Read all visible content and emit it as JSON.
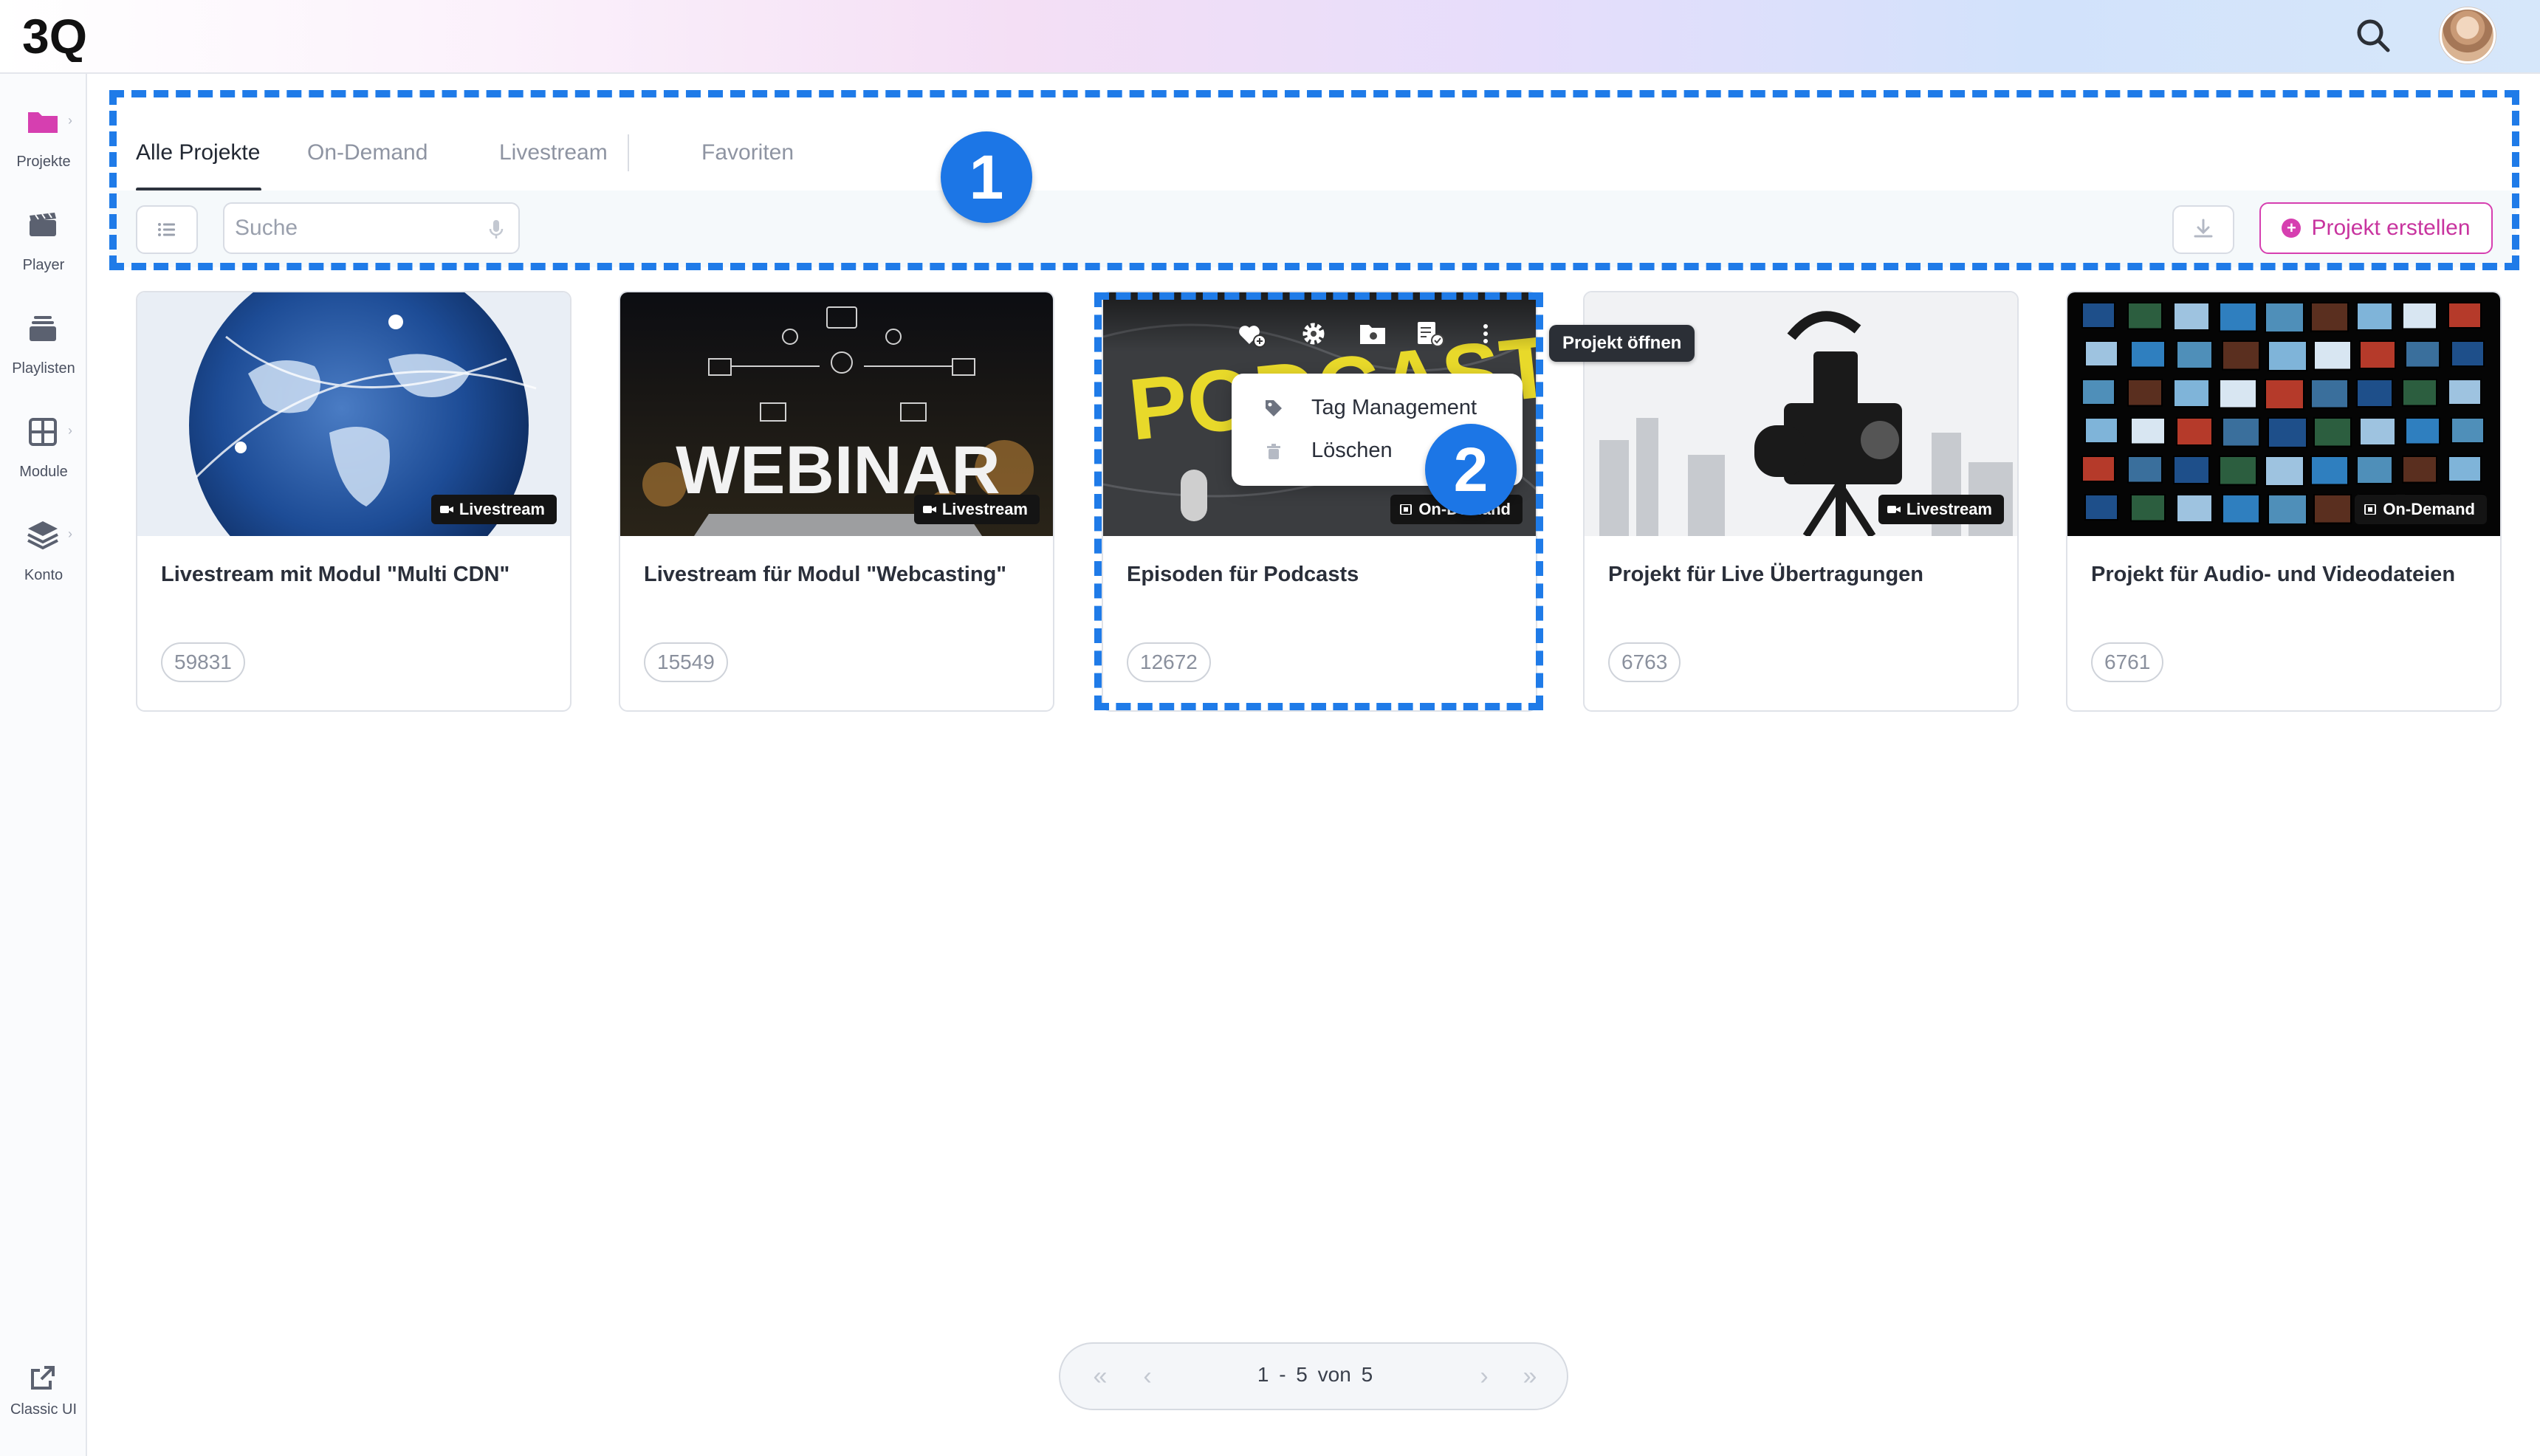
{
  "app": {
    "logo_text": "3Q"
  },
  "sidebar": {
    "items": [
      {
        "label": "Projekte",
        "icon": "folder-icon"
      },
      {
        "label": "Player",
        "icon": "clapperboard-icon"
      },
      {
        "label": "Playlisten",
        "icon": "playlist-stack-icon"
      },
      {
        "label": "Module",
        "icon": "grid-icon"
      },
      {
        "label": "Konto",
        "icon": "layers-icon"
      }
    ],
    "footer": {
      "label": "Classic UI",
      "icon": "external-link-icon"
    }
  },
  "tabs": [
    "Alle Projekte",
    "On-Demand",
    "Livestream",
    "Favoriten"
  ],
  "search": {
    "placeholder": "Suche",
    "value": ""
  },
  "toolbar": {
    "create_label": "Projekt erstellen"
  },
  "annotations": {
    "badge1": "1",
    "badge2": "2"
  },
  "cards": [
    {
      "title": "Livestream mit Modul \"Multi CDN\"",
      "id": "59831",
      "type": "Livestream"
    },
    {
      "title": "Livestream für Modul \"Webcasting\"",
      "id": "15549",
      "type": "Livestream"
    },
    {
      "title": "Episoden für Podcasts",
      "id": "12672",
      "type": "On-Demand"
    },
    {
      "title": "Projekt für Live Übertragungen",
      "id": "6763",
      "type": "Livestream"
    },
    {
      "title": "Projekt für Audio- und Videodateien",
      "id": "6761",
      "type": "On-Demand"
    }
  ],
  "thumb_texts": {
    "webinar": "WEBINAR",
    "podcast": "PODCAST"
  },
  "context_menu": {
    "items": [
      "Tag Management",
      "Löschen"
    ]
  },
  "tooltip": "Projekt öffnen",
  "pagination": {
    "text": "1 - 5 von 5"
  },
  "colors": {
    "accent": "#d63fb0",
    "annotation": "#1f7be8",
    "tag_bg": "#141414"
  }
}
